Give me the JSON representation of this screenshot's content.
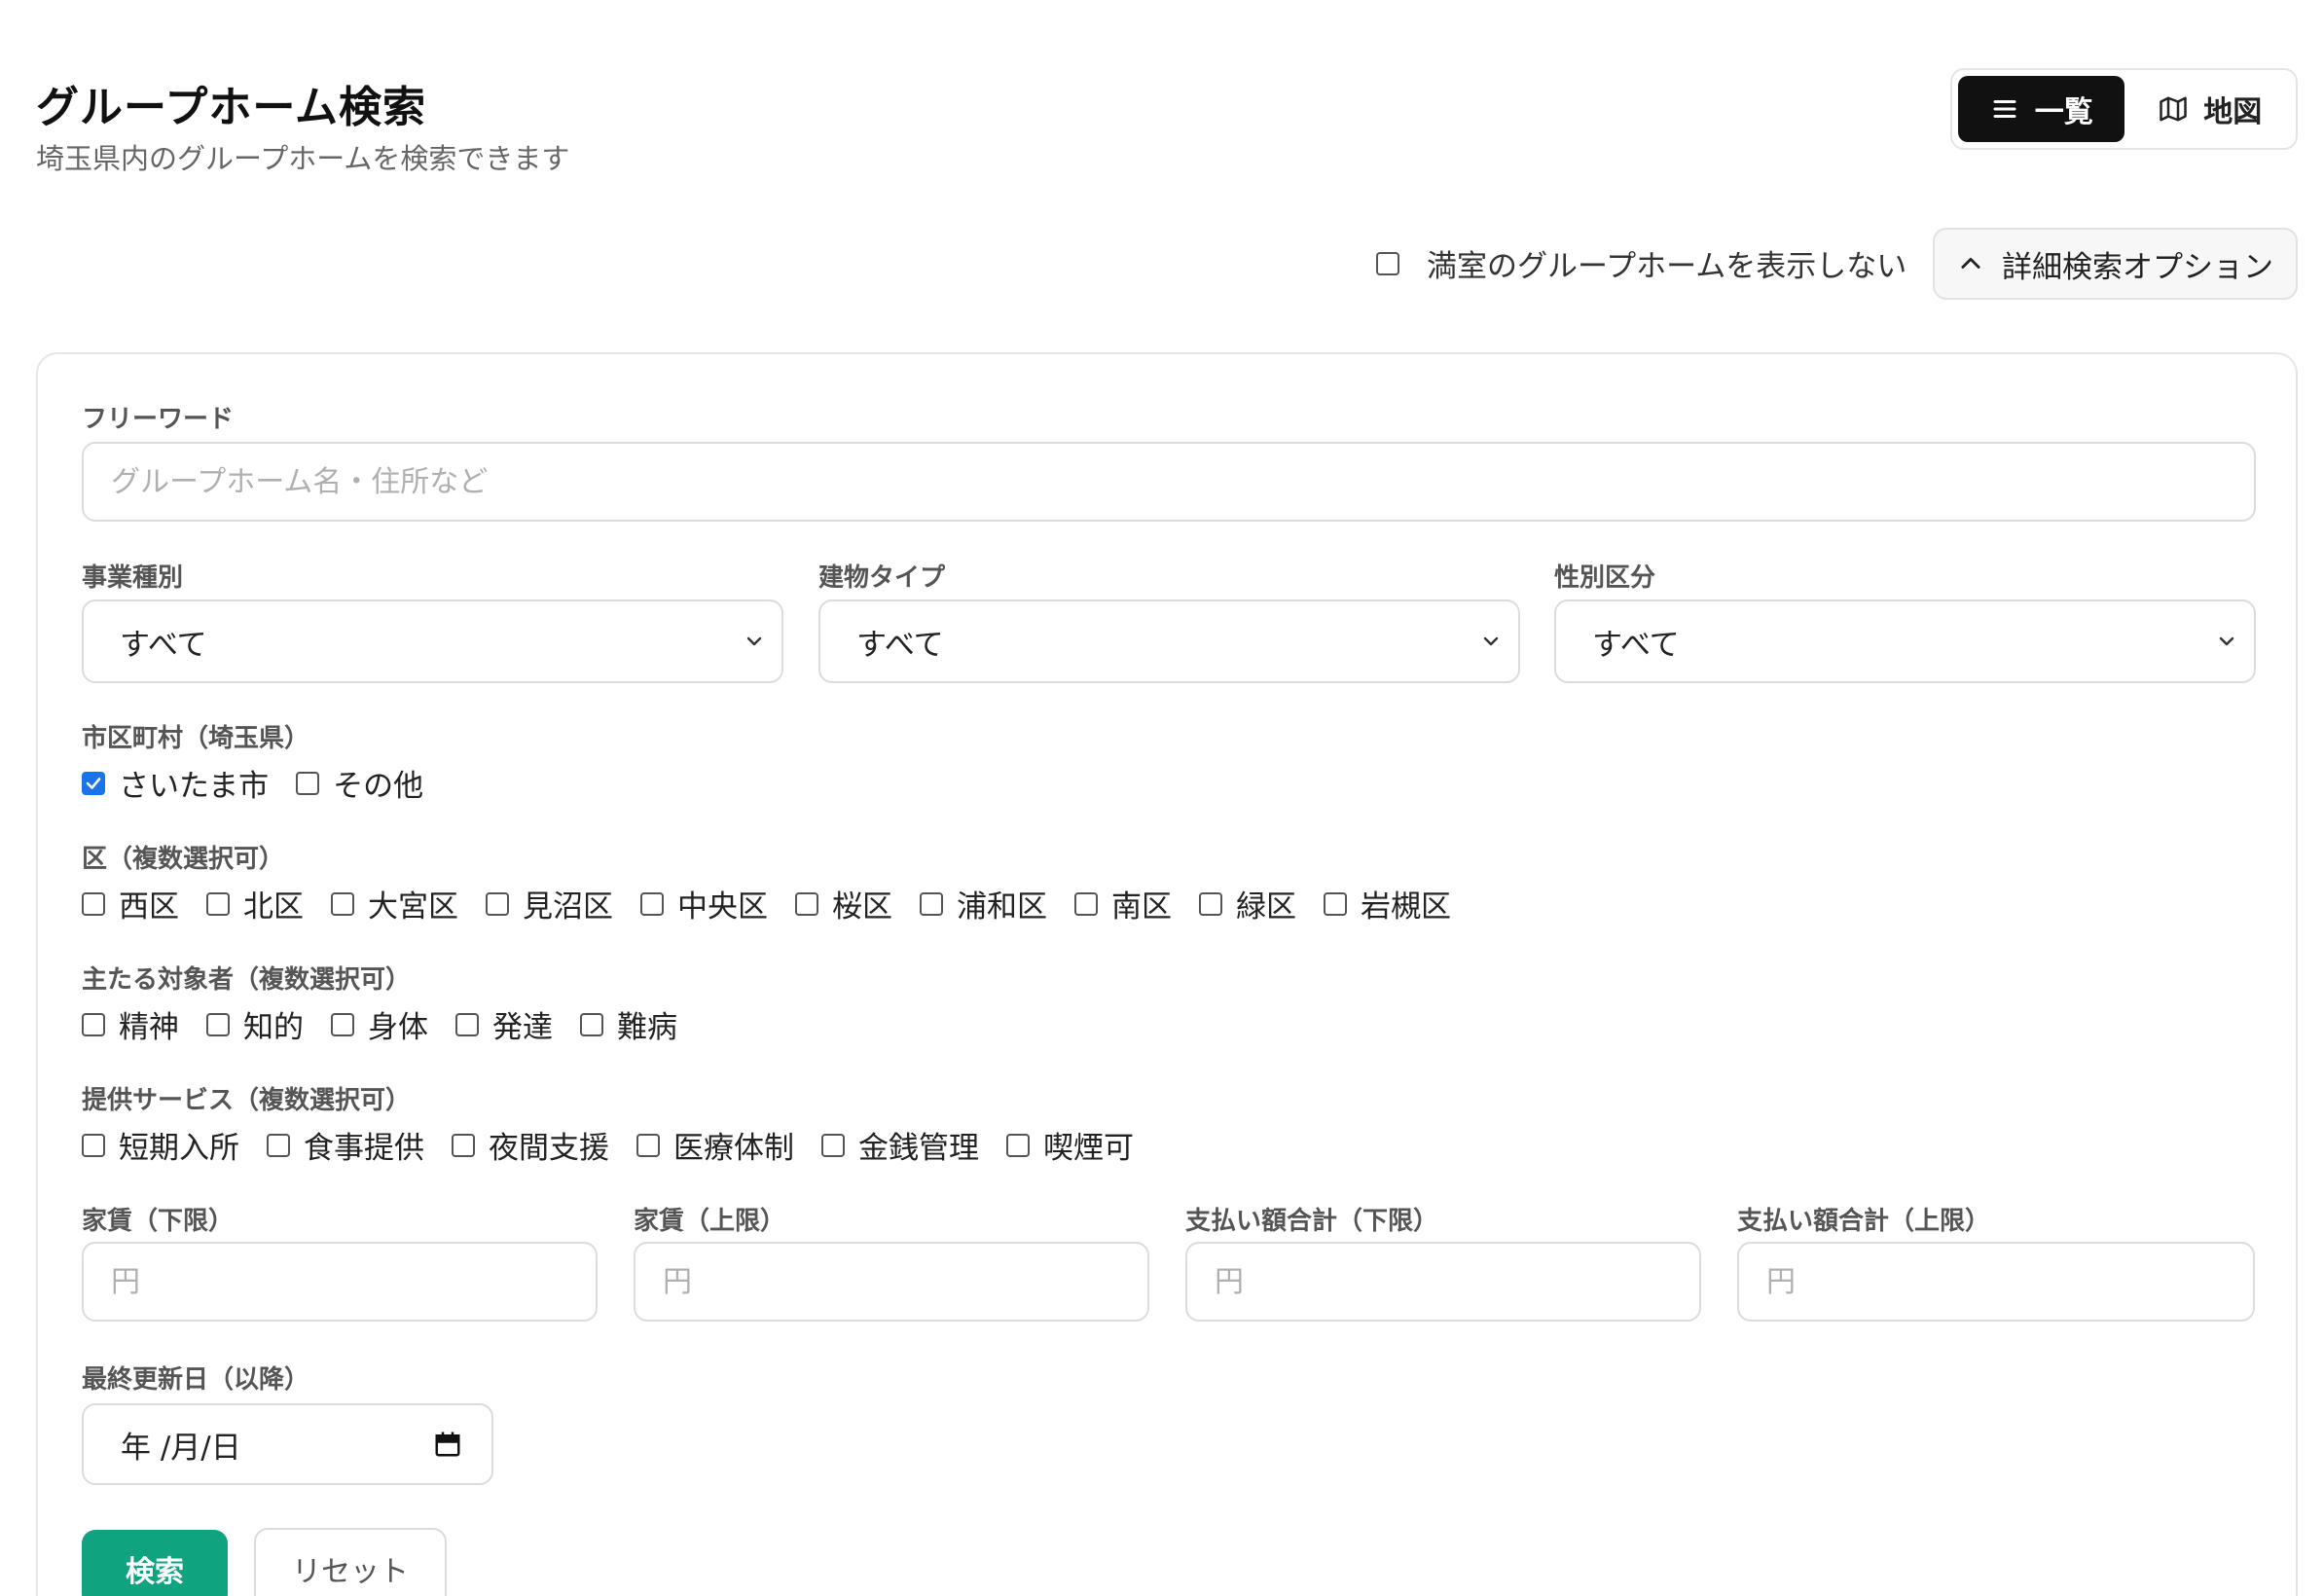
{
  "header": {
    "title": "グループホーム検索",
    "subtitle": "埼玉県内のグループホームを検索できます"
  },
  "view_toggle": {
    "list_label": "一覧",
    "map_label": "地図",
    "active": "list"
  },
  "options": {
    "hide_full_label": "満室のグループホームを表示しない",
    "hide_full_checked": false,
    "advanced_label": "詳細検索オプション"
  },
  "freeword": {
    "label": "フリーワード",
    "placeholder": "グループホーム名・住所など",
    "value": ""
  },
  "selects": [
    {
      "label": "事業種別",
      "value": "すべて"
    },
    {
      "label": "建物タイプ",
      "value": "すべて"
    },
    {
      "label": "性別区分",
      "value": "すべて"
    }
  ],
  "city": {
    "label": "市区町村（埼玉県）",
    "options": [
      {
        "label": "さいたま市",
        "checked": true
      },
      {
        "label": "その他",
        "checked": false
      }
    ]
  },
  "wards": {
    "label": "区（複数選択可）",
    "options": [
      {
        "label": "西区",
        "checked": false
      },
      {
        "label": "北区",
        "checked": false
      },
      {
        "label": "大宮区",
        "checked": false
      },
      {
        "label": "見沼区",
        "checked": false
      },
      {
        "label": "中央区",
        "checked": false
      },
      {
        "label": "桜区",
        "checked": false
      },
      {
        "label": "浦和区",
        "checked": false
      },
      {
        "label": "南区",
        "checked": false
      },
      {
        "label": "緑区",
        "checked": false
      },
      {
        "label": "岩槻区",
        "checked": false
      }
    ]
  },
  "targets": {
    "label": "主たる対象者（複数選択可）",
    "options": [
      {
        "label": "精神",
        "checked": false
      },
      {
        "label": "知的",
        "checked": false
      },
      {
        "label": "身体",
        "checked": false
      },
      {
        "label": "発達",
        "checked": false
      },
      {
        "label": "難病",
        "checked": false
      }
    ]
  },
  "services": {
    "label": "提供サービス（複数選択可）",
    "options": [
      {
        "label": "短期入所",
        "checked": false
      },
      {
        "label": "食事提供",
        "checked": false
      },
      {
        "label": "夜間支援",
        "checked": false
      },
      {
        "label": "医療体制",
        "checked": false
      },
      {
        "label": "金銭管理",
        "checked": false
      },
      {
        "label": "喫煙可",
        "checked": false
      }
    ]
  },
  "price_fields": [
    {
      "label": "家賃（下限）",
      "placeholder": "円"
    },
    {
      "label": "家賃（上限）",
      "placeholder": "円"
    },
    {
      "label": "支払い額合計（下限）",
      "placeholder": "円"
    },
    {
      "label": "支払い額合計（上限）",
      "placeholder": "円"
    }
  ],
  "updated": {
    "label": "最終更新日（以降）",
    "value": "年 /月/日"
  },
  "actions": {
    "search_label": "検索",
    "reset_label": "リセット"
  },
  "colors": {
    "primary": "#10a37f",
    "checkbox_checked": "#1a73e8",
    "toggle_active": "#111111"
  }
}
